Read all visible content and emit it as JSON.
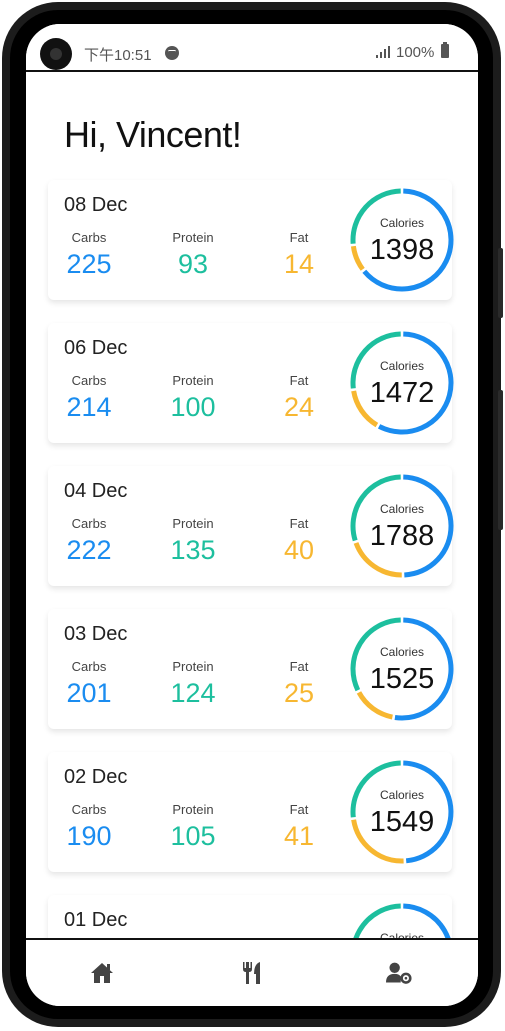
{
  "status": {
    "time": "下午10:51",
    "battery": "100%"
  },
  "greeting": "Hi, Vincent!",
  "labels": {
    "carbs": "Carbs",
    "protein": "Protein",
    "fat": "Fat",
    "calories": "Calories"
  },
  "colors": {
    "carbs": "#1a8cf0",
    "protein": "#1dbf9e",
    "fat": "#f7b731"
  },
  "entries": [
    {
      "date": "08 Dec",
      "carbs": "225",
      "protein": "93",
      "fat": "14",
      "calories": "1398"
    },
    {
      "date": "06 Dec",
      "carbs": "214",
      "protein": "100",
      "fat": "24",
      "calories": "1472"
    },
    {
      "date": "04 Dec",
      "carbs": "222",
      "protein": "135",
      "fat": "40",
      "calories": "1788"
    },
    {
      "date": "03 Dec",
      "carbs": "201",
      "protein": "124",
      "fat": "25",
      "calories": "1525"
    },
    {
      "date": "02 Dec",
      "carbs": "190",
      "protein": "105",
      "fat": "41",
      "calories": "1549"
    },
    {
      "date": "01 Dec",
      "carbs": "",
      "protein": "",
      "fat": "",
      "calories": ""
    }
  ],
  "nav": [
    {
      "icon": "home-icon"
    },
    {
      "icon": "utensils-icon"
    },
    {
      "icon": "user-settings-icon"
    }
  ]
}
